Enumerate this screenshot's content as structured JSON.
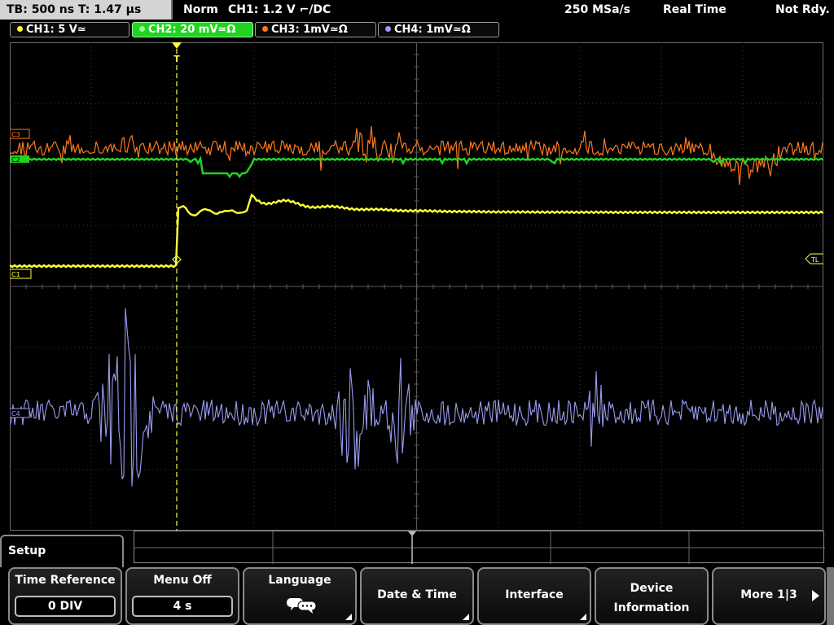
{
  "status": {
    "timebase": "TB: 500 ns   T: 1.47 µs",
    "mode": "Norm",
    "trigger": "CH1: 1.2 V ⌐/DC",
    "sample_rate": "250 MSa/s",
    "acq": "Real Time",
    "ready": "Not Rdy."
  },
  "channels": [
    {
      "label": "CH1: 5 V≃",
      "color": "#ffff3a",
      "active": false
    },
    {
      "label": "CH2: 20 mV≃Ω",
      "color": "#22d322",
      "active": true
    },
    {
      "label": "CH3: 1mV≃Ω",
      "color": "#ff7a1c",
      "active": false
    },
    {
      "label": "CH4: 1mV≃Ω",
      "color": "#9a9cf0",
      "active": false
    }
  ],
  "markers": {
    "c3": "C3",
    "c2": "C2",
    "c1": "C1",
    "c4": "C4",
    "trigger_level": "TL",
    "trigger_pos": "T"
  },
  "menu": {
    "title": "Setup",
    "softkeys": [
      {
        "title": "Time Reference",
        "value": "0 DIV"
      },
      {
        "title": "Menu Off",
        "value": "4 s"
      },
      {
        "title": "Language",
        "icon": "speech-bubble-icon"
      },
      {
        "title": "Date & Time"
      },
      {
        "title": "Interface"
      },
      {
        "title": "Device Information"
      },
      {
        "title": "More 1|3"
      }
    ]
  }
}
